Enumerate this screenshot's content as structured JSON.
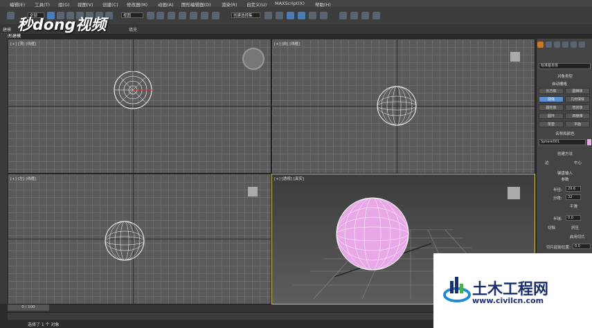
{
  "menu": [
    "编辑(E)",
    "工具(T)",
    "组(G)",
    "视图(V)",
    "创建(C)",
    "修改器(M)",
    "动画(A)",
    "图形编辑器(D)",
    "渲染(R)",
    "自定义(U)",
    "MAXScript(X)",
    "帮助(H)"
  ],
  "toolbar": {
    "filter_value": "全部",
    "view_value": "视图",
    "selection_set": "创建选择集"
  },
  "ribbon": {
    "tab1": "建模",
    "tab2": "多边形建模",
    "tab3": "填充"
  },
  "viewports": {
    "top": "[+] [顶] [线框]",
    "front": "[+] [前] [线框]",
    "left": "[+] [左] [线框]",
    "persp": "[+] [透视] [真实]"
  },
  "command_panel": {
    "category": "标准基本体",
    "object_type_title": "对象类型",
    "autogrid": "自动栅格",
    "buttons": [
      "长方体",
      "圆锥体",
      "球体",
      "几何球体",
      "圆柱体",
      "管状体",
      "圆环",
      "四棱锥",
      "茶壶",
      "平面"
    ],
    "name_color_title": "名称和颜色",
    "object_name": "Sphere001",
    "creation_method_title": "创建方法",
    "method_edge": "边",
    "method_center": "中心",
    "keyboard_entry": "键盘输入",
    "params_title": "参数",
    "radius_label": "半径:",
    "radius_value": "29.6",
    "segments_label": "分段:",
    "segments_value": "32",
    "smooth": "平滑",
    "hemisphere_label": "半球:",
    "hemisphere_value": "0.0",
    "chop": "切除",
    "squash": "挤压",
    "enable_slice": "启用切片",
    "slice_from": "切片起始位置:",
    "slice_from_value": "0.0"
  },
  "timeline": {
    "slider_label": "0 / 100"
  },
  "status": {
    "message": "选择了 1 个 对象"
  },
  "watermark": {
    "logo": "秒dong视频",
    "brand": "土木工程网",
    "url": "www.civilcn.com"
  },
  "colors": {
    "sphere_selected": "#e8a8e8",
    "viewport_active_border": "#c9c25a",
    "accent": "#5b8fd0"
  }
}
